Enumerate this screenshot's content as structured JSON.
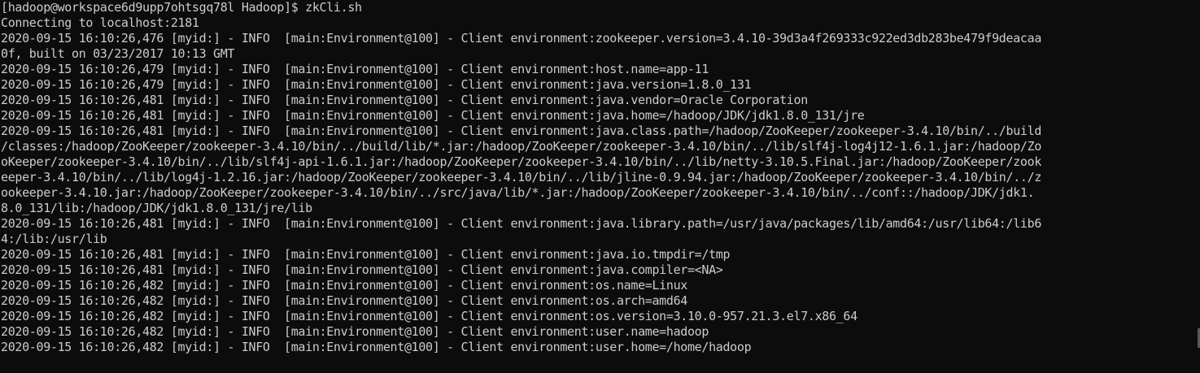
{
  "terminal": {
    "lines": [
      "[hadoop@workspace6d9upp7ohtsgq78l Hadoop]$ zkCli.sh",
      "Connecting to localhost:2181",
      "2020-09-15 16:10:26,476 [myid:] - INFO  [main:Environment@100] - Client environment:zookeeper.version=3.4.10-39d3a4f269333c922ed3db283be479f9deacaa",
      "0f, built on 03/23/2017 10:13 GMT",
      "2020-09-15 16:10:26,479 [myid:] - INFO  [main:Environment@100] - Client environment:host.name=app-11",
      "2020-09-15 16:10:26,479 [myid:] - INFO  [main:Environment@100] - Client environment:java.version=1.8.0_131",
      "2020-09-15 16:10:26,481 [myid:] - INFO  [main:Environment@100] - Client environment:java.vendor=Oracle Corporation",
      "2020-09-15 16:10:26,481 [myid:] - INFO  [main:Environment@100] - Client environment:java.home=/hadoop/JDK/jdk1.8.0_131/jre",
      "2020-09-15 16:10:26,481 [myid:] - INFO  [main:Environment@100] - Client environment:java.class.path=/hadoop/ZooKeeper/zookeeper-3.4.10/bin/../build",
      "/classes:/hadoop/ZooKeeper/zookeeper-3.4.10/bin/../build/lib/*.jar:/hadoop/ZooKeeper/zookeeper-3.4.10/bin/../lib/slf4j-log4j12-1.6.1.jar:/hadoop/Zo",
      "oKeeper/zookeeper-3.4.10/bin/../lib/slf4j-api-1.6.1.jar:/hadoop/ZooKeeper/zookeeper-3.4.10/bin/../lib/netty-3.10.5.Final.jar:/hadoop/ZooKeeper/zook",
      "eeper-3.4.10/bin/../lib/log4j-1.2.16.jar:/hadoop/ZooKeeper/zookeeper-3.4.10/bin/../lib/jline-0.9.94.jar:/hadoop/ZooKeeper/zookeeper-3.4.10/bin/../z",
      "ookeeper-3.4.10.jar:/hadoop/ZooKeeper/zookeeper-3.4.10/bin/../src/java/lib/*.jar:/hadoop/ZooKeeper/zookeeper-3.4.10/bin/../conf::/hadoop/JDK/jdk1.",
      "8.0_131/lib:/hadoop/JDK/jdk1.8.0_131/jre/lib",
      "2020-09-15 16:10:26,481 [myid:] - INFO  [main:Environment@100] - Client environment:java.library.path=/usr/java/packages/lib/amd64:/usr/lib64:/lib6",
      "4:/lib:/usr/lib",
      "2020-09-15 16:10:26,481 [myid:] - INFO  [main:Environment@100] - Client environment:java.io.tmpdir=/tmp",
      "2020-09-15 16:10:26,481 [myid:] - INFO  [main:Environment@100] - Client environment:java.compiler=<NA>",
      "2020-09-15 16:10:26,482 [myid:] - INFO  [main:Environment@100] - Client environment:os.name=Linux",
      "2020-09-15 16:10:26,482 [myid:] - INFO  [main:Environment@100] - Client environment:os.arch=amd64",
      "2020-09-15 16:10:26,482 [myid:] - INFO  [main:Environment@100] - Client environment:os.version=3.10.0-957.21.3.el7.x86_64",
      "2020-09-15 16:10:26,482 [myid:] - INFO  [main:Environment@100] - Client environment:user.name=hadoop",
      "2020-09-15 16:10:26,482 [myid:] - INFO  [main:Environment@100] - Client environment:user.home=/home/hadoop"
    ]
  },
  "colors": {
    "background": "#0c0c0c",
    "foreground": "#cccccc",
    "scrollbar_thumb": "#5a5a5a"
  }
}
